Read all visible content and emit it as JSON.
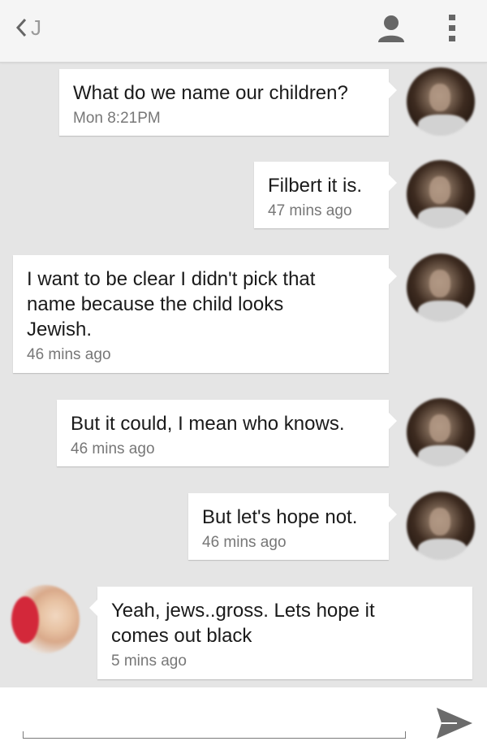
{
  "header": {
    "contact_title": "J",
    "back_icon": "chevron-left-icon",
    "contact_icon": "person-icon",
    "menu_icon": "overflow-menu-icon"
  },
  "messages": [
    {
      "direction": "outgoing",
      "text": "What do we name our children?",
      "time": "Mon 8:21PM"
    },
    {
      "direction": "outgoing",
      "text": "Filbert it is.",
      "time": "47 mins ago"
    },
    {
      "direction": "outgoing",
      "text": "I want to be clear I didn't pick that\nname because the child looks\nJewish.",
      "time": "46 mins ago"
    },
    {
      "direction": "outgoing",
      "text": "But it could, I mean who knows.",
      "time": "46 mins ago"
    },
    {
      "direction": "outgoing",
      "text": "But let's hope not.",
      "time": "46 mins ago"
    },
    {
      "direction": "incoming",
      "text": "Yeah, jews..gross. Lets hope it\ncomes out black",
      "time": "5 mins ago"
    }
  ],
  "composer": {
    "placeholder": "",
    "send_icon": "send-icon"
  },
  "colors": {
    "thread_background": "#e5e5e5",
    "bubble": "#ffffff",
    "header": "#f5f5f5",
    "icon": "#666666"
  }
}
